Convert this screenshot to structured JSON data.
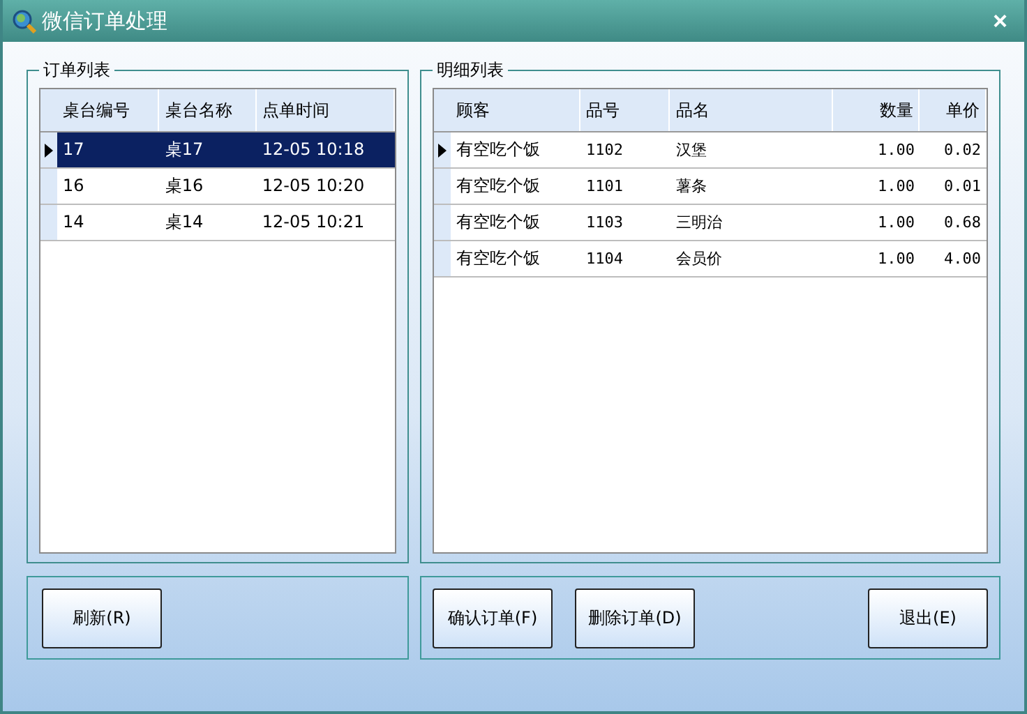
{
  "window": {
    "title": "微信订单处理",
    "close": "×"
  },
  "orders": {
    "title": "订单列表",
    "columns": [
      "桌台编号",
      "桌台名称",
      "点单时间"
    ],
    "rows": [
      {
        "cells": [
          "17",
          "桌17",
          "12-05 10:18"
        ],
        "selected": true
      },
      {
        "cells": [
          "16",
          "桌16",
          "12-05 10:20"
        ],
        "selected": false
      },
      {
        "cells": [
          "14",
          "桌14",
          "12-05 10:21"
        ],
        "selected": false
      }
    ]
  },
  "details": {
    "title": "明细列表",
    "columns": [
      "顾客",
      "品号",
      "品名",
      "数量",
      "单价"
    ],
    "rows": [
      {
        "cells": [
          "有空吃个饭",
          "1102",
          "汉堡",
          "1.00",
          "0.02"
        ],
        "selected": true
      },
      {
        "cells": [
          "有空吃个饭",
          "1101",
          "薯条",
          "1.00",
          "0.01"
        ],
        "selected": false
      },
      {
        "cells": [
          "有空吃个饭",
          "1103",
          "三明治",
          "1.00",
          "0.68"
        ],
        "selected": false
      },
      {
        "cells": [
          "有空吃个饭",
          "1104",
          "会员价",
          "1.00",
          "4.00"
        ],
        "selected": false
      }
    ]
  },
  "left_buttons": [
    "刷新(R)"
  ],
  "right_buttons": [
    "确认订单(F)",
    "删除订单(D)"
  ],
  "exit_button": "退出(E)"
}
